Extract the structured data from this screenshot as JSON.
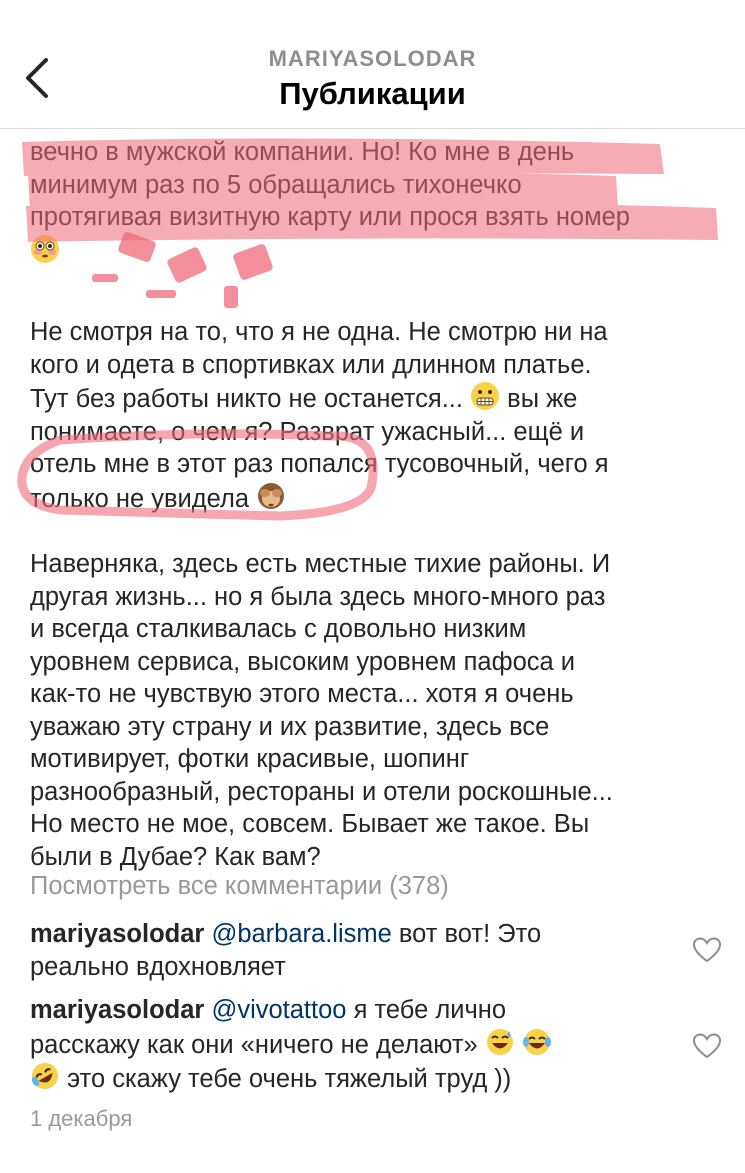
{
  "header": {
    "username": "MARIYASOLODAR",
    "title": "Публикации"
  },
  "caption": {
    "paragraph1": [
      "вечно в мужской компании. Но! Ко мне в день",
      "минимум раз по 5 обращались тихонечко",
      "протягивая визитную карту или прося взять номер"
    ],
    "paragraph2": [
      "Не смотря на то, что я не одна. Не смотрю ни на",
      "кого и одета в спортивках или длинном платье.",
      "Тут без работы никто не останется...",
      " вы же",
      "понимаете, о чем я? Разврат ужасный... ещё и",
      "отель мне в этот раз попался тусовочный, чего я",
      "только не увидела"
    ],
    "paragraph3": [
      "Наверняка, здесь есть местные тихие районы. И",
      "другая жизнь... но я была здесь много-много раз",
      "и всегда сталкивалась с довольно низким",
      "уровнем сервиса, высоким уровнем пафоса и",
      "как-то не чувствую этого места... хотя я очень",
      "уважаю эту страну и их развитие, здесь все",
      "мотивирует, фотки красивые, шопинг",
      "разнообразный, рестораны и отели роскошные...",
      "Но место не мое, совсем. Бывает же такое. Вы",
      "были в Дубае? Как вам?"
    ]
  },
  "view_all_comments": "Посмотреть все комментарии (378)",
  "comments": [
    {
      "user": "mariyasolodar",
      "mention": "@barbara.lisme",
      "text1": " вот вот! Это",
      "text2": "реально вдохновляет"
    },
    {
      "user": "mariyasolodar",
      "mention": "@vivotattoo",
      "text1": " я тебе лично",
      "text2": "расскажу как они «ничего не делают»",
      "text3": " это скажу тебе очень тяжелый труд ))"
    }
  ],
  "date": "1 декабря",
  "colors": {
    "highlight": "#f06a7a",
    "mention": "#003569",
    "muted": "#999999"
  },
  "icons": {
    "back": "chevron-left-icon",
    "heart": "heart-outline-icon",
    "flushed": "flushed-face-emoji",
    "grimacing": "grimacing-face-emoji",
    "see_no_evil": "see-no-evil-monkey-emoji",
    "sweat_smile": "sweat-smile-emoji",
    "joy": "joy-emoji",
    "rofl": "rofl-emoji"
  }
}
